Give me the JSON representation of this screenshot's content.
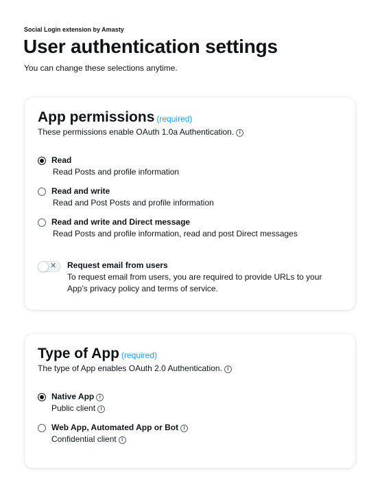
{
  "header": {
    "byline": "Social Login extension by Amasty",
    "title": "User authentication settings",
    "subtitle": "You can change these selections anytime."
  },
  "permissions": {
    "title": "App permissions",
    "required": "(required)",
    "description": "These permissions enable OAuth 1.0a Authentication.",
    "options": [
      {
        "label": "Read",
        "desc": "Read Posts and profile information",
        "selected": true
      },
      {
        "label": "Read and write",
        "desc": "Read and Post Posts and profile information",
        "selected": false
      },
      {
        "label": "Read and write and Direct message",
        "desc": "Read Posts and profile information, read and post Direct messages",
        "selected": false
      }
    ],
    "email_toggle": {
      "label": "Request email from users",
      "description": "To request email from users, you are required to provide URLs to your App’s privacy policy and terms of service.",
      "enabled": false
    }
  },
  "app_type": {
    "title": "Type of App",
    "required": "(required)",
    "description": "The type of App enables OAuth 2.0 Authentication.",
    "options": [
      {
        "label": "Native App",
        "desc": "Public client",
        "selected": true
      },
      {
        "label": "Web App, Automated App or Bot",
        "desc": "Confidential client",
        "selected": false
      }
    ]
  },
  "colors": {
    "accent": "#1d9bf0",
    "text": "#0f1419",
    "muted": "#536471"
  },
  "icons": {
    "info": "info-circle-icon",
    "toggle_off": "x-icon"
  }
}
